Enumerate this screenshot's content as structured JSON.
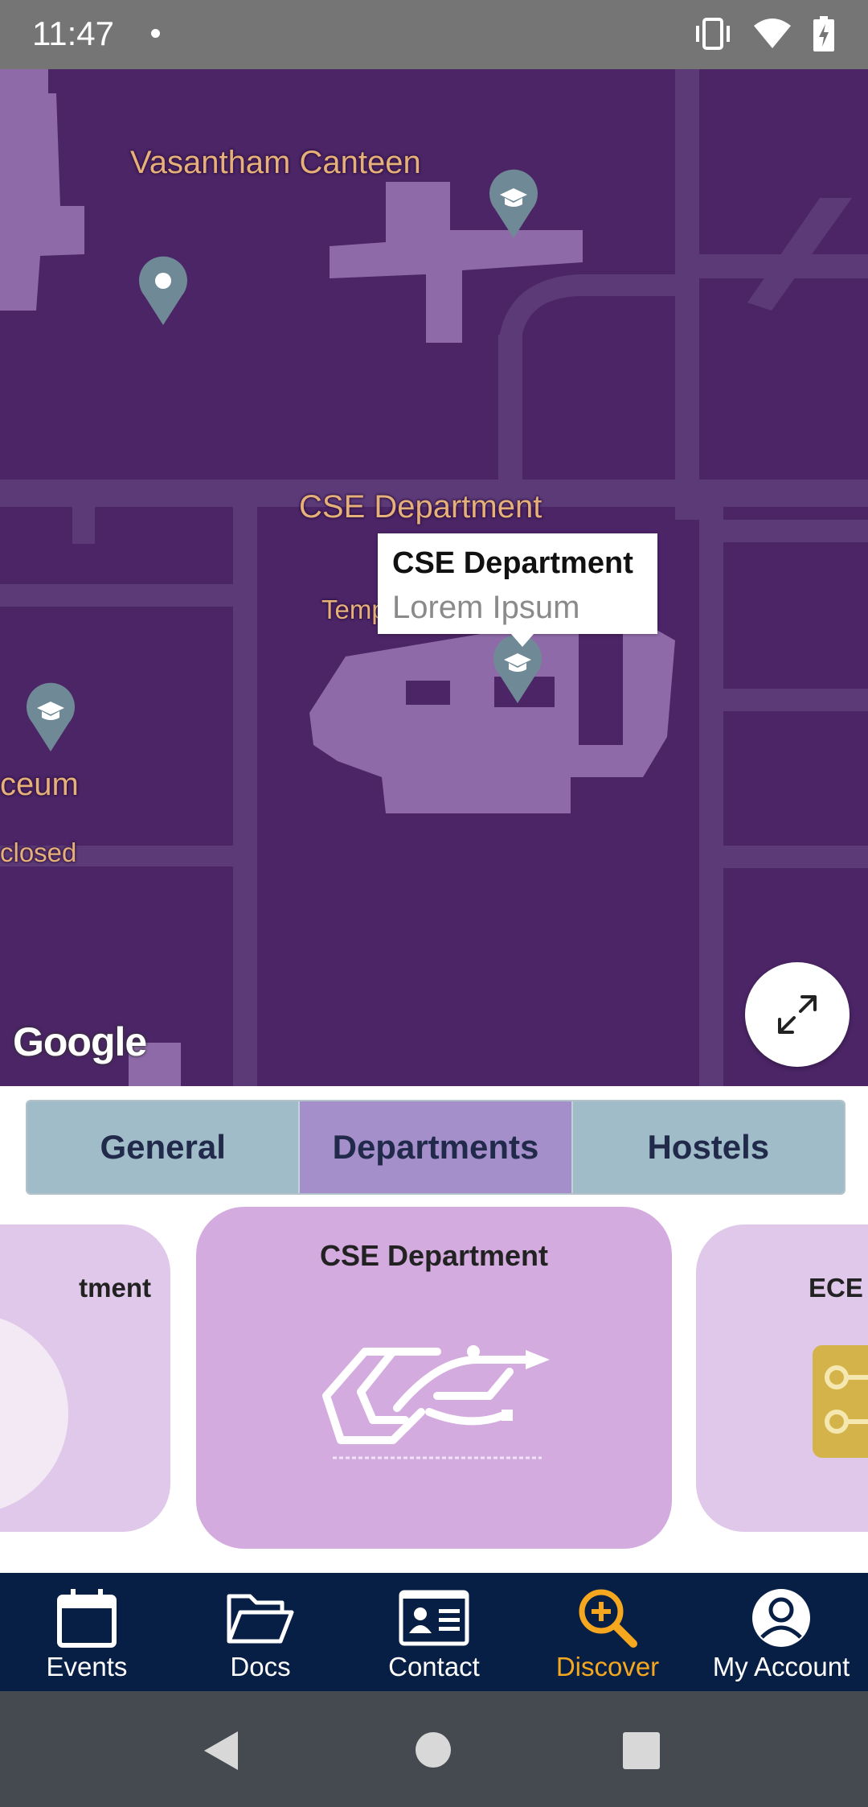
{
  "status_bar": {
    "time": "11:47",
    "icons": [
      "vibrate-icon",
      "wifi-icon",
      "battery-charging-icon"
    ]
  },
  "map": {
    "labels": {
      "canteen": "Vasantham Canteen",
      "cse": "CSE Department",
      "temp": "Temp",
      "lyceum": "ceum",
      "closed": "closed"
    },
    "info_window": {
      "title": "CSE Department",
      "snippet": "Lorem Ipsum"
    },
    "attribution": "Google",
    "pin_color": "#6f8a96",
    "background_color": "#4b2566",
    "building_color": "#8e6aa8"
  },
  "tabs": {
    "items": [
      {
        "label": "General",
        "active": false
      },
      {
        "label": "Departments",
        "active": true
      },
      {
        "label": "Hostels",
        "active": false
      }
    ],
    "active_color": "#a48fca",
    "inactive_color": "#a0bcc8"
  },
  "carousel": {
    "left_title": "tment",
    "center_title": "CSE Department",
    "right_title": "ECE"
  },
  "bottom_nav": {
    "items": [
      {
        "label": "Events",
        "icon": "calendar-icon"
      },
      {
        "label": "Docs",
        "icon": "folder-open-icon"
      },
      {
        "label": "Contact",
        "icon": "contact-card-icon"
      },
      {
        "label": "Discover",
        "icon": "search-plus-icon",
        "active": true
      },
      {
        "label": "My Account",
        "icon": "account-circle-icon"
      }
    ],
    "active_color": "#f5a81f",
    "background_color": "#081f45"
  },
  "system_nav": {
    "buttons": [
      "back-icon",
      "home-icon",
      "recents-icon"
    ]
  }
}
